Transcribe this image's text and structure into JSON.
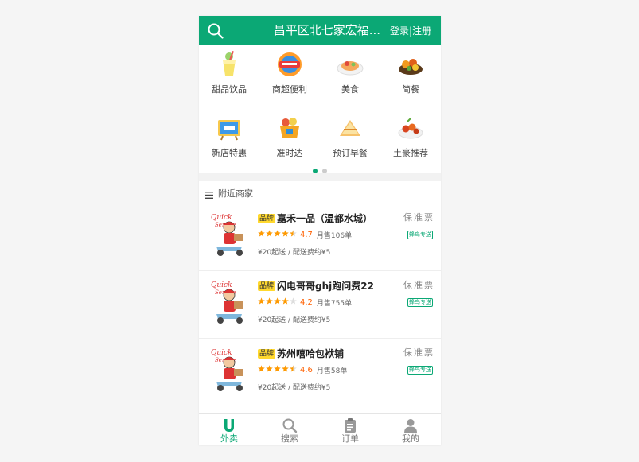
{
  "header": {
    "search_icon": "search-icon",
    "title": "昌平区北七家宏福...",
    "login_label": "登录|注册"
  },
  "categories": [
    {
      "label": "甜品饮品",
      "icon": "drink-icon"
    },
    {
      "label": "商超便利",
      "icon": "supermarket-icon"
    },
    {
      "label": "美食",
      "icon": "food-icon"
    },
    {
      "label": "简餐",
      "icon": "meal-icon"
    },
    {
      "label": "新店特惠",
      "icon": "new-shop-icon"
    },
    {
      "label": "准时达",
      "icon": "on-time-icon"
    },
    {
      "label": "预订早餐",
      "icon": "breakfast-icon"
    },
    {
      "label": "土豪推荐",
      "icon": "recommend-icon"
    }
  ],
  "carousel": {
    "pages": 2,
    "active": 0
  },
  "shops_section": {
    "title": "附近商家",
    "icon": "menu-icon"
  },
  "shops": [
    {
      "badge": "品牌",
      "name": "嘉禾一品（温都水城）",
      "tags": "保准票",
      "rating": 4.7,
      "rating_text": "4.7",
      "sales": "月售106单",
      "delivery": "蜂鸟专送",
      "fee": "¥20起送 / 配送费约¥5"
    },
    {
      "badge": "品牌",
      "name": "闪电哥哥ghj跑问费22",
      "tags": "保准票",
      "rating": 4.2,
      "rating_text": "4.2",
      "sales": "月售755单",
      "delivery": "蜂鸟专送",
      "fee": "¥20起送 / 配送费约¥5"
    },
    {
      "badge": "品牌",
      "name": "苏州嘻哈包袱铺",
      "tags": "保准票",
      "rating": 4.6,
      "rating_text": "4.6",
      "sales": "月售58单",
      "delivery": "蜂鸟专送",
      "fee": "¥20起送 / 配送费约¥5"
    }
  ],
  "tabs": [
    {
      "label": "外卖",
      "icon": "takeaway-icon",
      "active": true
    },
    {
      "label": "搜索",
      "icon": "search-icon",
      "active": false
    },
    {
      "label": "订单",
      "icon": "order-icon",
      "active": false
    },
    {
      "label": "我的",
      "icon": "profile-icon",
      "active": false
    }
  ],
  "colors": {
    "brand": "#0ba875",
    "badge": "#ffd82e",
    "star": "#ff9a00",
    "rating": "#ff6000"
  }
}
